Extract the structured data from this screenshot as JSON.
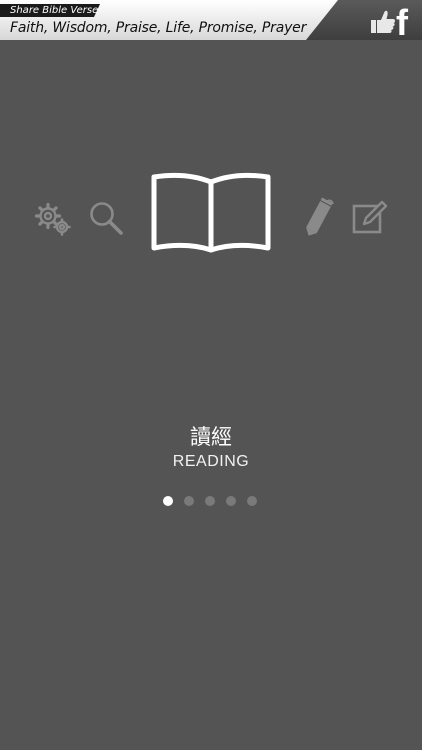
{
  "banner": {
    "small_label": "Share Bible Verse",
    "main_label": "Faith, Wisdom, Praise, Life, Promise, Prayer"
  },
  "toolbar": {
    "icons": [
      "settings-gears-icon",
      "search-icon",
      "book-icon",
      "bookmark-pen-icon",
      "edit-note-icon"
    ],
    "selected": "book-icon"
  },
  "feature": {
    "title_zh": "讀經",
    "title_en": "READING"
  },
  "pager": {
    "count": 5,
    "active_index": 0
  },
  "colors": {
    "background": "#545454",
    "icon_dim": "#8a8a8a",
    "icon_active": "#ffffff",
    "dot_inactive": "#7a7a7a",
    "dot_active": "#ffffff"
  }
}
